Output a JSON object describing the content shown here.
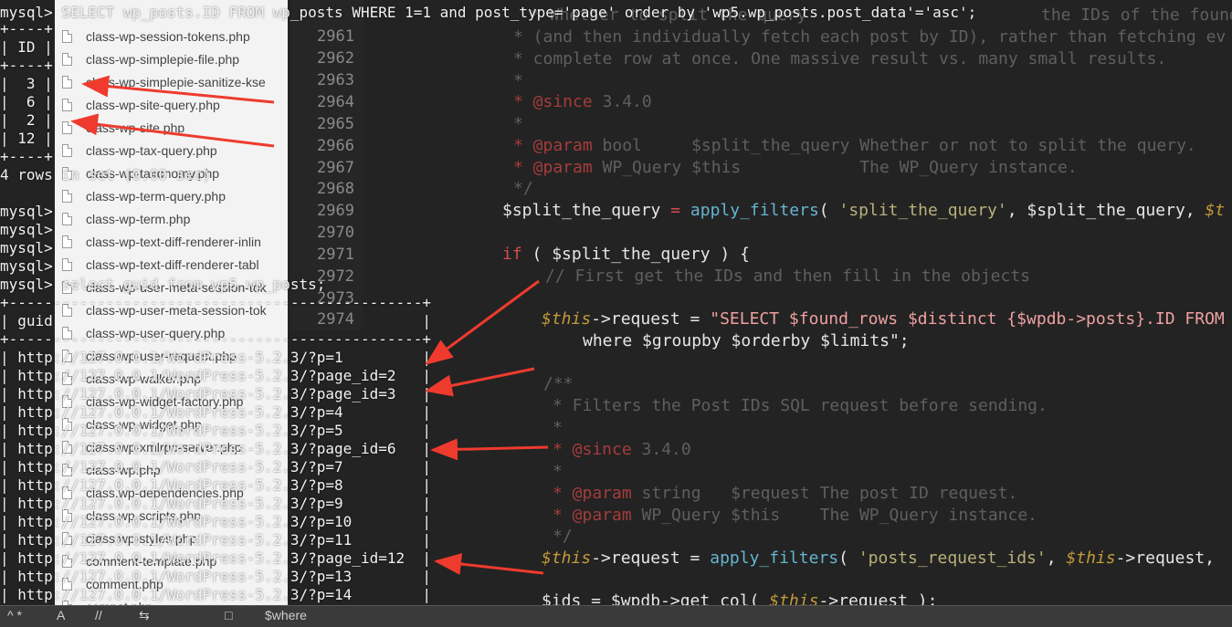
{
  "terminal": {
    "query1": "mysql> SELECT wp_posts.ID FROM wp_posts WHERE 1=1 and post_type='page' order by 'wp5.wp_posts.post_data'='asc';",
    "cursor_char": "F",
    "table1": {
      "border": "+----+",
      "header": "| ID |",
      "rows": [
        "|  3 |",
        "|  6 |",
        "|  2 |",
        "| 12 |"
      ]
    },
    "summary": "4 rows in set (0.00 sec)",
    "prompts": [
      "mysql>",
      "mysql>",
      "mysql>",
      "mysql>"
    ],
    "query2": "mysql> select guid from wp5.wp_posts;",
    "table2": {
      "border": "+-----------------------------------------------+",
      "header": "| guid                                          |",
      "rows": [
        "| http://127.0.0.1/WordPress-5.2.3/?p=1         |",
        "| http://127.0.0.1/WordPress-5.2.3/?page_id=2   |",
        "| http://127.0.0.1/WordPress-5.2.3/?page_id=3   |",
        "| http://127.0.0.1/WordPress-5.2.3/?p=4         |",
        "| http://127.0.0.1/WordPress-5.2.3/?p=5         |",
        "| http://127.0.0.1/WordPress-5.2.3/?page_id=6   |",
        "| http://127.0.0.1/WordPress-5.2.3/?p=7         |",
        "| http://127.0.0.1/WordPress-5.2.3/?p=8         |",
        "| http://127.0.0.1/WordPress-5.2.3/?p=9         |",
        "| http://127.0.0.1/WordPress-5.2.3/?p=10        |",
        "| http://127.0.0.1/WordPress-5.2.3/?p=11        |",
        "| http://127.0.0.1/WordPress-5.2.3/?page_id=12  |",
        "| http://127.0.0.1/WordPress-5.2.3/?p=13        |",
        "| http://127.0.0.1/WordPress-5.2.3/?p=14        |"
      ]
    }
  },
  "filetree": {
    "files": [
      "class-wp-session-tokens.php",
      "class-wp-simplepie-file.php",
      "class-wp-simplepie-sanitize-kse",
      "class-wp-site-query.php",
      "class-wp-site.php",
      "class-wp-tax-query.php",
      "class-wp-taxonomy.php",
      "class-wp-term-query.php",
      "class-wp-term.php",
      "class-wp-text-diff-renderer-inlin",
      "class-wp-text-diff-renderer-tabl",
      "class-wp-user-meta-session-tok",
      "class-wp-user-meta-session-tok",
      "class-wp-user-query.php",
      "class-wp-user-request.php",
      "class-wp-walker.php",
      "class-wp-widget-factory.php",
      "class-wp-widget.php",
      "class-wp-xmlrpc-server.php",
      "class-wp.php",
      "class.wp-dependencies.php",
      "class.wp-scripts.php",
      "class.wp-styles.php",
      "comment-template.php",
      "comment.php",
      "compat.php"
    ]
  },
  "editor": {
    "line_numbers": [
      "2961",
      "2962",
      "2963",
      "2964",
      "2965",
      "2966",
      "2967",
      "2968",
      "2969",
      "2970",
      "2971",
      "2972",
      "2973",
      "2974"
    ],
    "lines": {
      "l0a": "* Whether to split the query",
      "l0b": "the IDs of the found p",
      "l1": "* (and then individually fetch each post by ID), rather than fetching ev",
      "l2": "* complete row at once. One massive result vs. many small results.",
      "l3": "*",
      "l4_tag": "* @since",
      "l4_val": " 3.4.0",
      "l5": "*",
      "l6_tag": "* @param",
      "l6_val": " bool     $split_the_query Whether or not to split the query.",
      "l7_tag": "* @param",
      "l7_val": " WP_Query $this            The WP_Query instance.",
      "l8": "*/",
      "l9_var": "$split_the_query",
      "l9_op": " = ",
      "l9_fn": "apply_filters",
      "l9_p": "( ",
      "l9_str": "'split_the_query'",
      "l9_rest": ", $split_the_query, ",
      "l9_end": "$t",
      "l10_kw": "if",
      "l10_rest": " ( $split_the_query ) {",
      "l11": "// First get the IDs and then fill in the objects",
      "l12_this": "$this",
      "l12_op": "->request = ",
      "l12_str": "\"SELECT $found_rows $distinct {$wpdb->posts}.ID FROM",
      "l13": "where $groupby $orderby $limits\";",
      "l14": "/**",
      "l15": "* Filters the Post IDs SQL request before sending.",
      "l16": "*",
      "l17_tag": "* @since",
      "l17_val": " 3.4.0",
      "l18": "*",
      "l19_tag": "* @param",
      "l19_val": " string   $request The post ID request.",
      "l20_tag": "* @param",
      "l20_val": " WP_Query $this    The WP_Query instance.",
      "l21": "*/",
      "l22_this": "$this",
      "l22_op": "->request = ",
      "l22_fn": "apply_filters",
      "l22_p": "( ",
      "l22_str": "'posts_request_ids'",
      "l22_rest": ", ",
      "l22_this2": "$this",
      "l22_end": "->request,",
      "l23_var": "$ids = ",
      "l23_rest": "$wpdb->get_col( ",
      "l23_this": "$this",
      "l23_end": "->request );"
    }
  },
  "statusbar": {
    "items": [
      "^ *",
      "A",
      "//",
      "⇆ ",
      "□",
      "$where"
    ]
  },
  "colors": {
    "arrow": "#ee3b2e",
    "editor_bg": "#232323",
    "tree_bg": "#f3f3f3"
  }
}
